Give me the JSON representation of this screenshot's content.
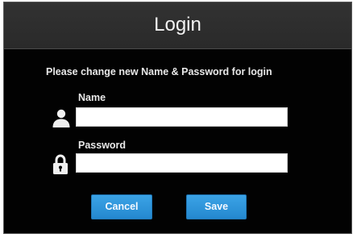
{
  "dialog": {
    "title": "Login",
    "instruction": "Please change new Name & Password for login",
    "name_field": {
      "label": "Name",
      "value": "",
      "icon": "user-icon"
    },
    "password_field": {
      "label": "Password",
      "value": "",
      "icon": "lock-icon"
    },
    "buttons": {
      "cancel_label": "Cancel",
      "save_label": "Save"
    }
  },
  "colors": {
    "background": "#020202",
    "titlebar": "#2f2f2f",
    "text": "#e8e8e8",
    "button": "#2e95dc"
  }
}
